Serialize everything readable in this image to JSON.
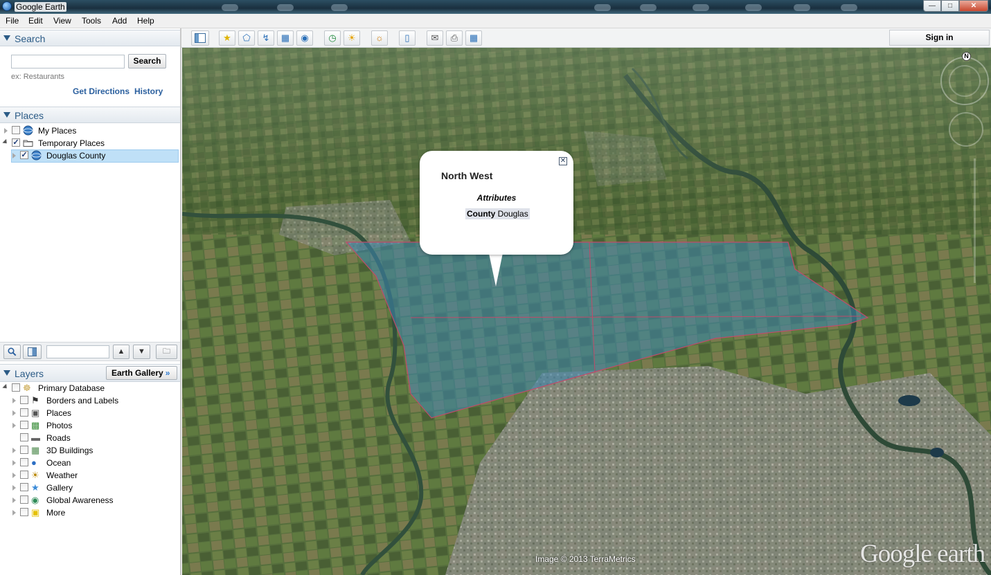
{
  "window": {
    "title": "Google Earth"
  },
  "menu": [
    "File",
    "Edit",
    "View",
    "Tools",
    "Add",
    "Help"
  ],
  "search": {
    "header": "Search",
    "input_value": "",
    "button_label": "Search",
    "hint": "ex: Restaurants",
    "get_directions": "Get Directions",
    "history": "History"
  },
  "places": {
    "header": "Places",
    "items": [
      {
        "label": "My Places",
        "checked": false,
        "icon": "globe-icon"
      },
      {
        "label": "Temporary Places",
        "checked": true,
        "icon": "folder-icon"
      },
      {
        "label": "Douglas County",
        "checked": true,
        "icon": "globe-icon",
        "selected": true
      }
    ]
  },
  "layers": {
    "header": "Layers",
    "gallery_button": "Earth Gallery",
    "items": [
      {
        "label": "Primary Database",
        "icon": "database-icon"
      },
      {
        "label": "Borders and Labels",
        "icon": "flag-icon"
      },
      {
        "label": "Places",
        "icon": "place-square-icon"
      },
      {
        "label": "Photos",
        "icon": "photo-icon"
      },
      {
        "label": "Roads",
        "icon": "road-icon"
      },
      {
        "label": "3D Buildings",
        "icon": "building-icon"
      },
      {
        "label": "Ocean",
        "icon": "ocean-icon"
      },
      {
        "label": "Weather",
        "icon": "sun-icon"
      },
      {
        "label": "Gallery",
        "icon": "star-icon"
      },
      {
        "label": "Global Awareness",
        "icon": "globe-awareness-icon"
      },
      {
        "label": "More",
        "icon": "note-icon"
      }
    ]
  },
  "toolbar": {
    "sign_in": "Sign in"
  },
  "map": {
    "balloon": {
      "name": "North West",
      "attributes_label": "Attributes",
      "attr_key": "County",
      "attr_value": "Douglas"
    },
    "compass_label": "N",
    "credit": "Image © 2013 TerraMetrics",
    "logo_text": "Google earth"
  },
  "colors": {
    "accent": "#2b5b86",
    "overlay": "#3d86b3",
    "selection": "#bfe0f7"
  }
}
